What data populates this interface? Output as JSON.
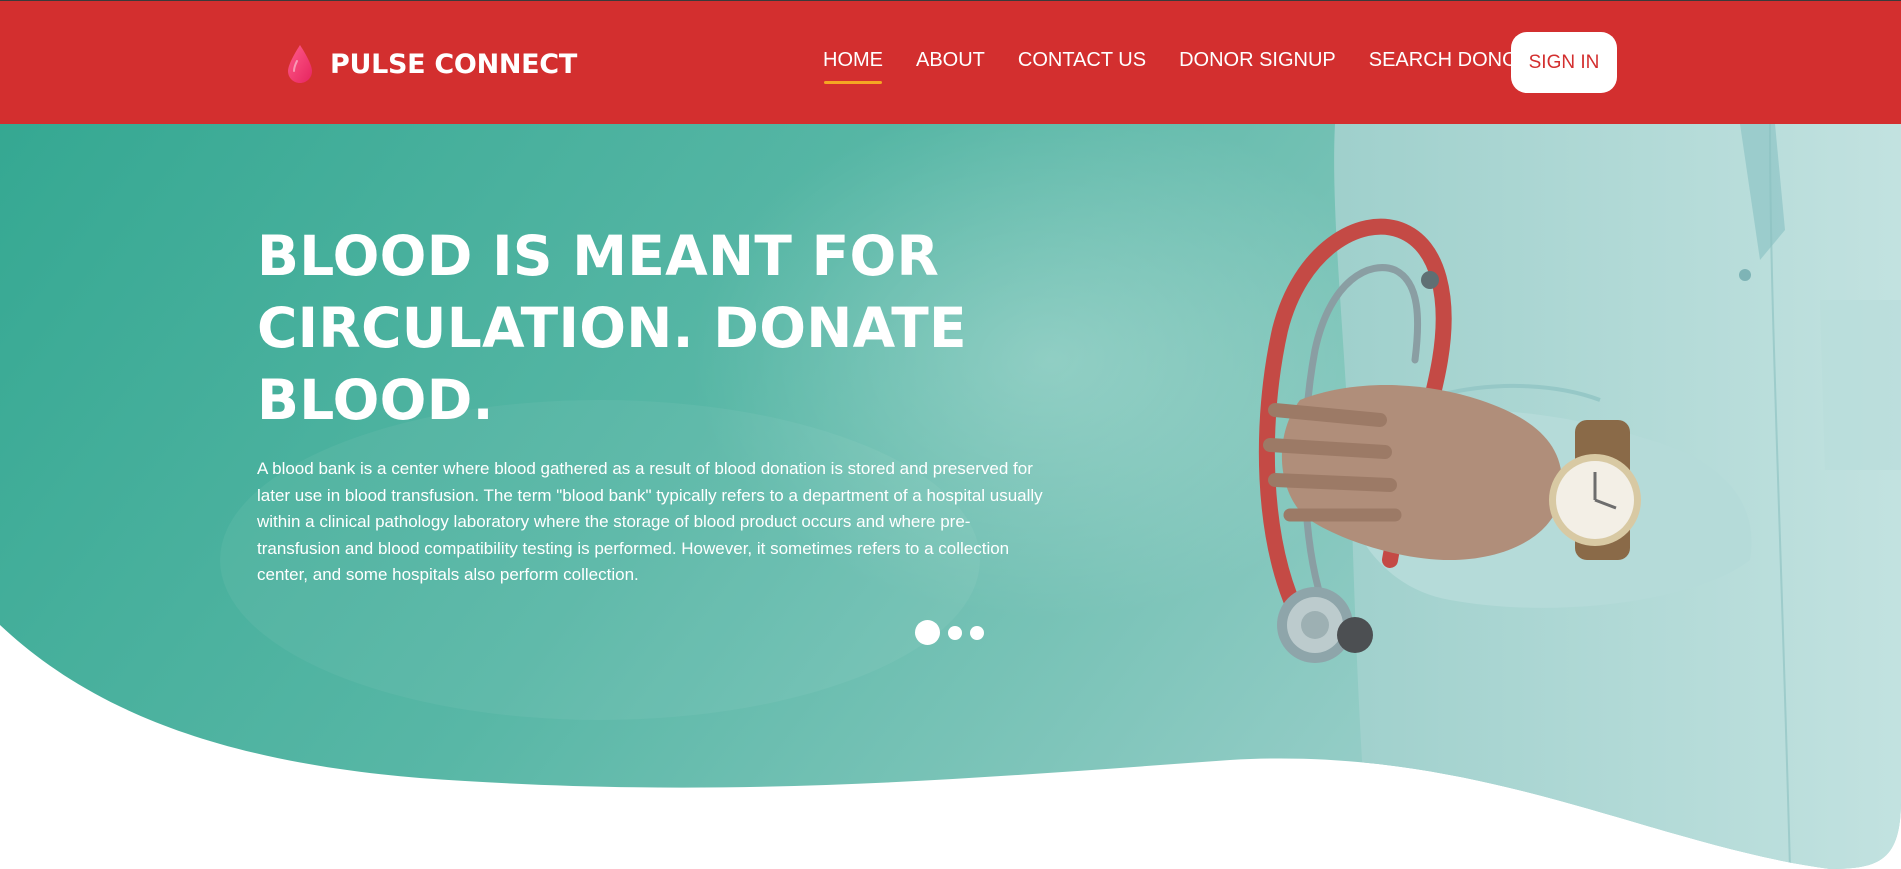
{
  "brand": {
    "name": "PULSE CONNECT",
    "icon": "blood-drop-icon"
  },
  "nav": {
    "items": [
      {
        "label": "HOME",
        "active": true
      },
      {
        "label": "ABOUT",
        "active": false
      },
      {
        "label": "CONTACT US",
        "active": false
      },
      {
        "label": "DONOR SIGNUP",
        "active": false
      },
      {
        "label": "SEARCH DONOR",
        "active": false
      }
    ],
    "signin_label": "SIGN IN"
  },
  "hero": {
    "title_lines": [
      "BLOOD IS MEANT FOR",
      "CIRCULATION. DONATE",
      "BLOOD."
    ],
    "description": "A blood bank is a center where blood gathered as a result of blood donation is stored and preserved for later use in blood transfusion. The term \"blood bank\" typically refers to a department of a hospital usually within a clinical pathology laboratory where the storage of blood product occurs and where pre-transfusion and blood compatibility testing is performed. However, it sometimes refers to a collection center, and some hospitals also perform collection.",
    "image": "doctor-with-stethoscope-photo",
    "carousel": {
      "slides": 3,
      "active_index": 0
    }
  },
  "colors": {
    "nav_bg": "#d32f2f",
    "active_underline": "#f5a623",
    "hero_teal": "#3fae98",
    "signin_text": "#d32f2f",
    "text_white": "#ffffff"
  }
}
